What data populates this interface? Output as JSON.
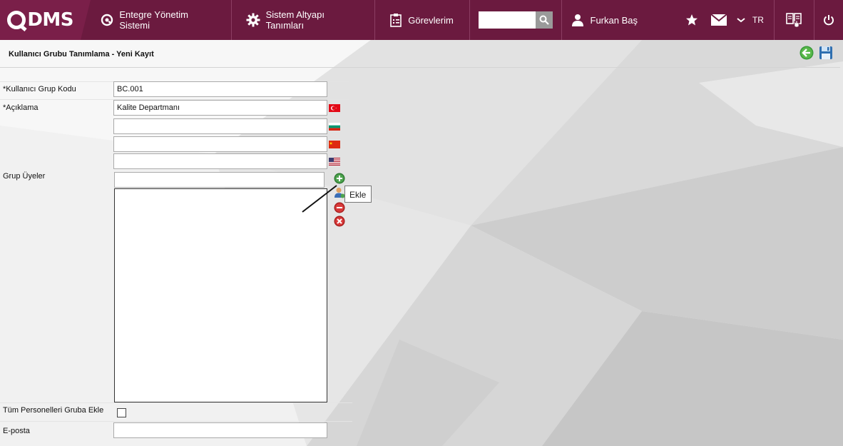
{
  "app": {
    "logo_text": "DMS",
    "nav": {
      "entegre": "Entegre Yönetim Sistemi",
      "sistem": "Sistem Altyapı Tanımları",
      "gorevler": "Görevlerim"
    },
    "search_value": "",
    "user_name": "Furkan Baş",
    "language": "TR"
  },
  "page": {
    "title": "Kullanıcı Grubu Tanımlama - Yeni Kayıt"
  },
  "form": {
    "group_code_label": "*Kullanıcı Grup Kodu",
    "group_code_value": "BC.001",
    "description_label": "*Açıklama",
    "description_tr": "Kalite Departmanı",
    "description_bg": "",
    "description_cn": "",
    "description_en": "",
    "members_label": "Grup Üyeler",
    "members_search_value": "",
    "add_all_label": "Tüm Personelleri Gruba Ekle",
    "email_label": "E-posta",
    "email_value": "",
    "tooltip_text": "Ekle"
  },
  "colors": {
    "topbar": "#6b1a3f",
    "logo_bg": "#7a1f49",
    "add_green": "#3b8a3e",
    "remove_red": "#d32f2f"
  },
  "icons": {
    "nav_entegre": "qdms-circle-icon",
    "nav_sistem": "gear-icon",
    "nav_gorevler": "clipboard-icon",
    "search": "search-icon",
    "user": "user-icon",
    "favorites": "star-icon",
    "mail": "mail-icon",
    "lang_toggle": "chevron-down-icon",
    "guide": "book-icon",
    "logout": "power-icon",
    "back": "back-arrow-icon",
    "save": "save-icon"
  }
}
